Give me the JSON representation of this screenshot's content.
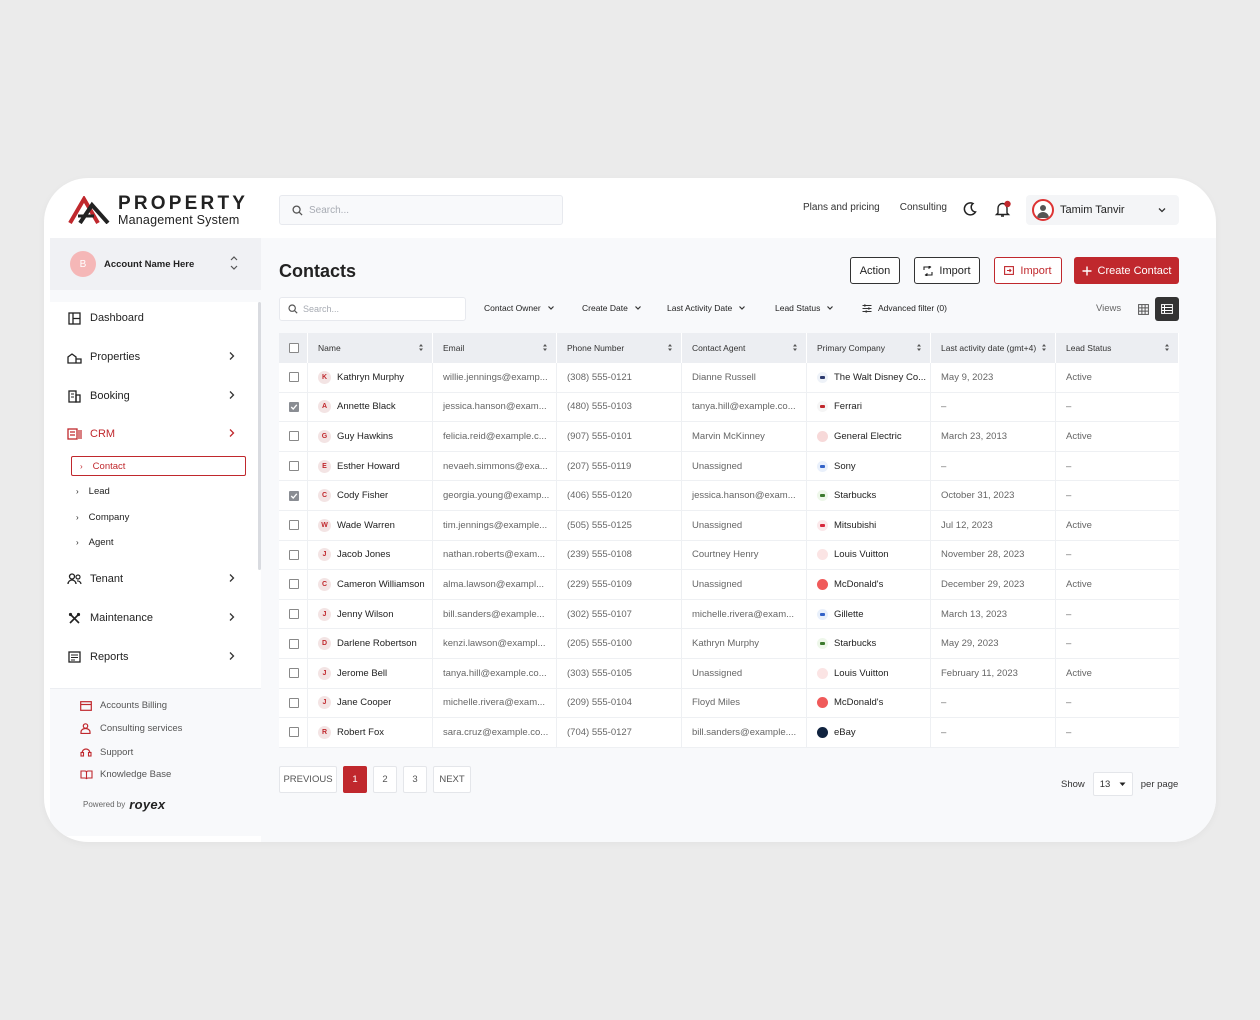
{
  "brand": {
    "title": "PROPERTY",
    "subtitle": "Management System",
    "accent": "#c0282d"
  },
  "header": {
    "search_placeholder": "Search...",
    "nav": [
      "Plans and pricing",
      "Consulting"
    ],
    "user_name": "Tamim Tanvir"
  },
  "account": {
    "badge": "B",
    "name": "Account Name Here"
  },
  "sidebar": {
    "items": [
      {
        "label": "Dashboard"
      },
      {
        "label": "Properties"
      },
      {
        "label": "Booking"
      },
      {
        "label": "CRM"
      },
      {
        "label": "Tenant"
      },
      {
        "label": "Maintenance"
      },
      {
        "label": "Reports"
      }
    ],
    "crm_sub": [
      "Contact",
      "Lead",
      "Company",
      "Agent"
    ],
    "bottom": [
      "Accounts Billing",
      "Consulting services",
      "Support",
      "Knowledge Base"
    ],
    "powered_by": "Powered by",
    "powered_brand": "royex"
  },
  "main": {
    "title": "Contacts",
    "buttons": {
      "action": "Action",
      "import1": "Import",
      "import2": "Import",
      "create": "Create Contact"
    },
    "filters": {
      "search_placeholder": "Search...",
      "contact_owner": "Contact Owner",
      "create_date": "Create Date",
      "last_activity": "Last Activity Date",
      "lead_status": "Lead Status",
      "advanced": "Advanced filter (0)",
      "views": "Views"
    },
    "table": {
      "columns": [
        "Name",
        "Email",
        "Phone Number",
        "Contact Agent",
        "Primary Company",
        "Last activity date (gmt+4)",
        "Lead Status"
      ],
      "rows": [
        {
          "initial": "K",
          "name": "Kathryn Murphy",
          "email": "willie.jennings@examp...",
          "phone": "(308) 555-0121",
          "agent": "Dianne Russell",
          "company": "The Walt Disney Co...",
          "date": "May 9, 2023",
          "status": "Active",
          "checked": false
        },
        {
          "initial": "A",
          "name": "Annette Black",
          "email": "jessica.hanson@exam...",
          "phone": "(480) 555-0103",
          "agent": "tanya.hill@example.co...",
          "company": "Ferrari",
          "date": "–",
          "status": "–",
          "checked": true
        },
        {
          "initial": "G",
          "name": "Guy Hawkins",
          "email": "felicia.reid@example.c...",
          "phone": "(907) 555-0101",
          "agent": "Marvin McKinney",
          "company": "General Electric",
          "date": "March 23, 2013",
          "status": "Active",
          "checked": false
        },
        {
          "initial": "E",
          "name": "Esther Howard",
          "email": "nevaeh.simmons@exa...",
          "phone": "(207) 555-0119",
          "agent": "Unassigned",
          "company": "Sony",
          "date": "–",
          "status": "–",
          "checked": false
        },
        {
          "initial": "C",
          "name": "Cody Fisher",
          "email": "georgia.young@examp...",
          "phone": "(406) 555-0120",
          "agent": "jessica.hanson@exam...",
          "company": "Starbucks",
          "date": "October 31, 2023",
          "status": "–",
          "checked": true
        },
        {
          "initial": "W",
          "name": "Wade Warren",
          "email": "tim.jennings@example...",
          "phone": "(505) 555-0125",
          "agent": "Unassigned",
          "company": "Mitsubishi",
          "date": "Jul 12, 2023",
          "status": "Active",
          "checked": false
        },
        {
          "initial": "J",
          "name": "Jacob Jones",
          "email": "nathan.roberts@exam...",
          "phone": "(239) 555-0108",
          "agent": "Courtney Henry",
          "company": "Louis Vuitton",
          "date": "November 28, 2023",
          "status": "–",
          "checked": false
        },
        {
          "initial": "C",
          "name": "Cameron Williamson",
          "email": "alma.lawson@exampl...",
          "phone": "(229) 555-0109",
          "agent": "Unassigned",
          "company": "McDonald's",
          "date": "December 29, 2023",
          "status": "Active",
          "checked": false
        },
        {
          "initial": "J",
          "name": "Jenny Wilson",
          "email": "bill.sanders@example...",
          "phone": "(302) 555-0107",
          "agent": "michelle.rivera@exam...",
          "company": "Gillette",
          "date": "March 13, 2023",
          "status": "–",
          "checked": false
        },
        {
          "initial": "D",
          "name": "Darlene Robertson",
          "email": "kenzi.lawson@exampl...",
          "phone": "(205) 555-0100",
          "agent": "Kathryn Murphy",
          "company": "Starbucks",
          "date": "May 29, 2023",
          "status": "–",
          "checked": false
        },
        {
          "initial": "J",
          "name": "Jerome Bell",
          "email": "tanya.hill@example.co...",
          "phone": "(303) 555-0105",
          "agent": "Unassigned",
          "company": "Louis Vuitton",
          "date": "February 11, 2023",
          "status": "Active",
          "checked": false
        },
        {
          "initial": "J",
          "name": "Jane Cooper",
          "email": "michelle.rivera@exam...",
          "phone": "(209) 555-0104",
          "agent": "Floyd Miles",
          "company": "McDonald's",
          "date": "–",
          "status": "–",
          "checked": false
        },
        {
          "initial": "R",
          "name": "Robert Fox",
          "email": "sara.cruz@example.co...",
          "phone": "(704) 555-0127",
          "agent": "bill.sanders@example....",
          "company": "eBay",
          "date": "–",
          "status": "–",
          "checked": false
        }
      ]
    },
    "pagination": {
      "previous": "PREVIOUS",
      "pages": [
        "1",
        "2",
        "3"
      ],
      "next": "NEXT",
      "current": "1"
    },
    "show": {
      "label": "Show",
      "value": "13",
      "suffix": "per page"
    }
  }
}
